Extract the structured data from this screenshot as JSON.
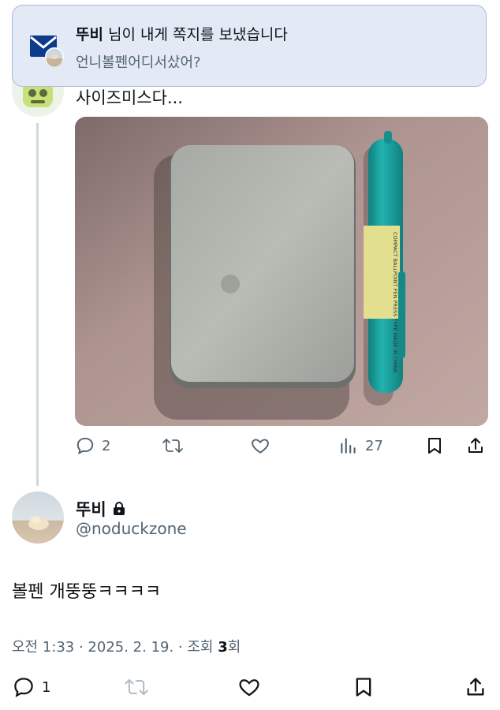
{
  "notification": {
    "sender": "뚜비",
    "message": " 님이 내게 쪽지를 보냈습니다",
    "preview": "언니볼펜어디서샀어?",
    "icon": "envelope-icon"
  },
  "thread_tweet": {
    "text": "사이즈미스다...",
    "avatar": "ghost-avatar",
    "image": "silver-tin-and-teal-pen-photo",
    "pen_label": "COMPACT BALLPOINT PEN PRESS TYPE MADE IN CHINA",
    "actions": {
      "reply_count": "2",
      "retweet_count": "",
      "like_count": "",
      "views_count": "27"
    }
  },
  "main_tweet": {
    "display_name": "뚜비",
    "handle": "@noduckzone",
    "text": "볼펜 개뚱뚱ㅋㅋㅋㅋ",
    "meta_time": "오전 1:33 · 2025. 2. 19. · 조회 ",
    "views": "3",
    "views_suffix": "회",
    "actions": {
      "reply_count": "1"
    }
  },
  "colors": {
    "accent_gray": "#536471",
    "teal_pen": "#1aa5a3",
    "notif_bg": "#e3eaf6"
  }
}
